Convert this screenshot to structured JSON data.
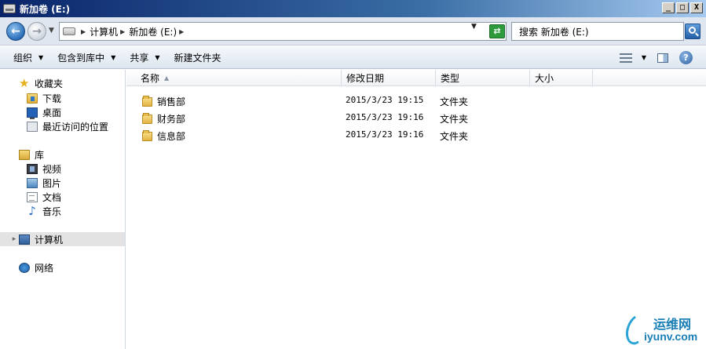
{
  "window": {
    "title": "新加卷 (E:)",
    "buttons": {
      "minimize": "_",
      "maximize": "□",
      "close": "X"
    }
  },
  "address": {
    "breadcrumbs": [
      "计算机",
      "新加卷 (E:)"
    ],
    "search_placeholder": "搜索 新加卷 (E:)"
  },
  "toolbar": {
    "items": [
      {
        "label": "组织",
        "has_dropdown": true
      },
      {
        "label": "包含到库中",
        "has_dropdown": true
      },
      {
        "label": "共享",
        "has_dropdown": true
      },
      {
        "label": "新建文件夹",
        "has_dropdown": false
      }
    ],
    "help": "?"
  },
  "navigation": {
    "favorites": {
      "label": "收藏夹",
      "items": [
        "下载",
        "桌面",
        "最近访问的位置"
      ]
    },
    "libraries": {
      "label": "库",
      "items": [
        "视频",
        "图片",
        "文档",
        "音乐"
      ]
    },
    "computer": {
      "label": "计算机",
      "selected": true
    },
    "network": {
      "label": "网络"
    }
  },
  "columns": [
    "名称",
    "修改日期",
    "类型",
    "大小"
  ],
  "files": [
    {
      "name": "销售部",
      "modified": "2015/3/23 19:15",
      "type": "文件夹",
      "size": ""
    },
    {
      "name": "财务部",
      "modified": "2015/3/23 19:16",
      "type": "文件夹",
      "size": ""
    },
    {
      "name": "信息部",
      "modified": "2015/3/23 19:16",
      "type": "文件夹",
      "size": ""
    }
  ],
  "watermark": {
    "cn": "运维网",
    "en": "iyunv.com"
  },
  "colors": {
    "title_bar": "#0a246a",
    "toolbar_bg": "#dde6f0",
    "selected_nav": "#e3e3e3"
  }
}
